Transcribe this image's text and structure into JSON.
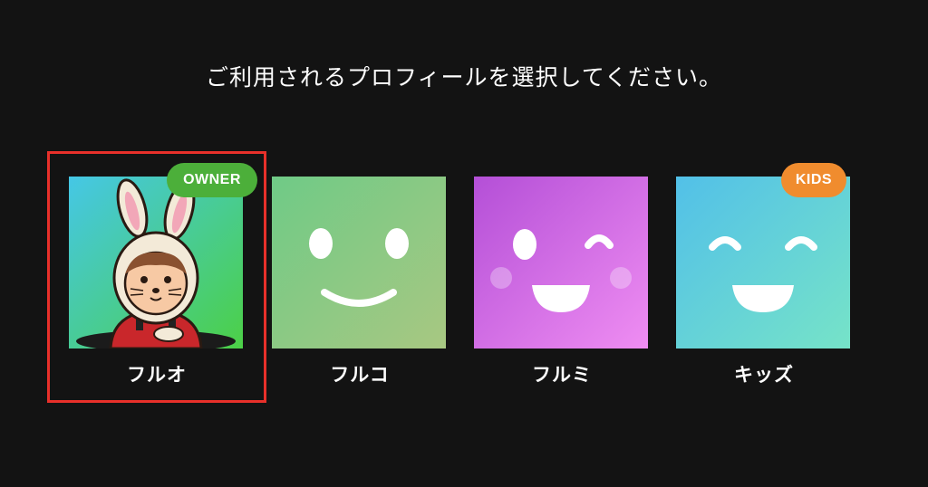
{
  "prompt": "ご利用されるプロフィールを選択してください。",
  "profiles": [
    {
      "name": "フルオ",
      "badge": "OWNER",
      "selected": true,
      "avatar": "rabbit-hood-character-icon",
      "bg": [
        "#45c7e6",
        "#4cd046"
      ]
    },
    {
      "name": "フルコ",
      "badge": "",
      "selected": false,
      "avatar": "smiling-face-icon",
      "bg": [
        "#6fca86",
        "#a8c882"
      ]
    },
    {
      "name": "フルミ",
      "badge": "",
      "selected": false,
      "avatar": "winking-face-icon",
      "bg": [
        "#b44fd7",
        "#ef8df2"
      ]
    },
    {
      "name": "キッズ",
      "badge": "KIDS",
      "selected": false,
      "avatar": "happy-face-icon",
      "bg": [
        "#52c0e8",
        "#76e3c8"
      ]
    }
  ],
  "colors": {
    "background": "#131313",
    "selection_outline": "#e8302a",
    "owner_badge": "#4caf3a",
    "kids_badge": "#f08c2e"
  }
}
